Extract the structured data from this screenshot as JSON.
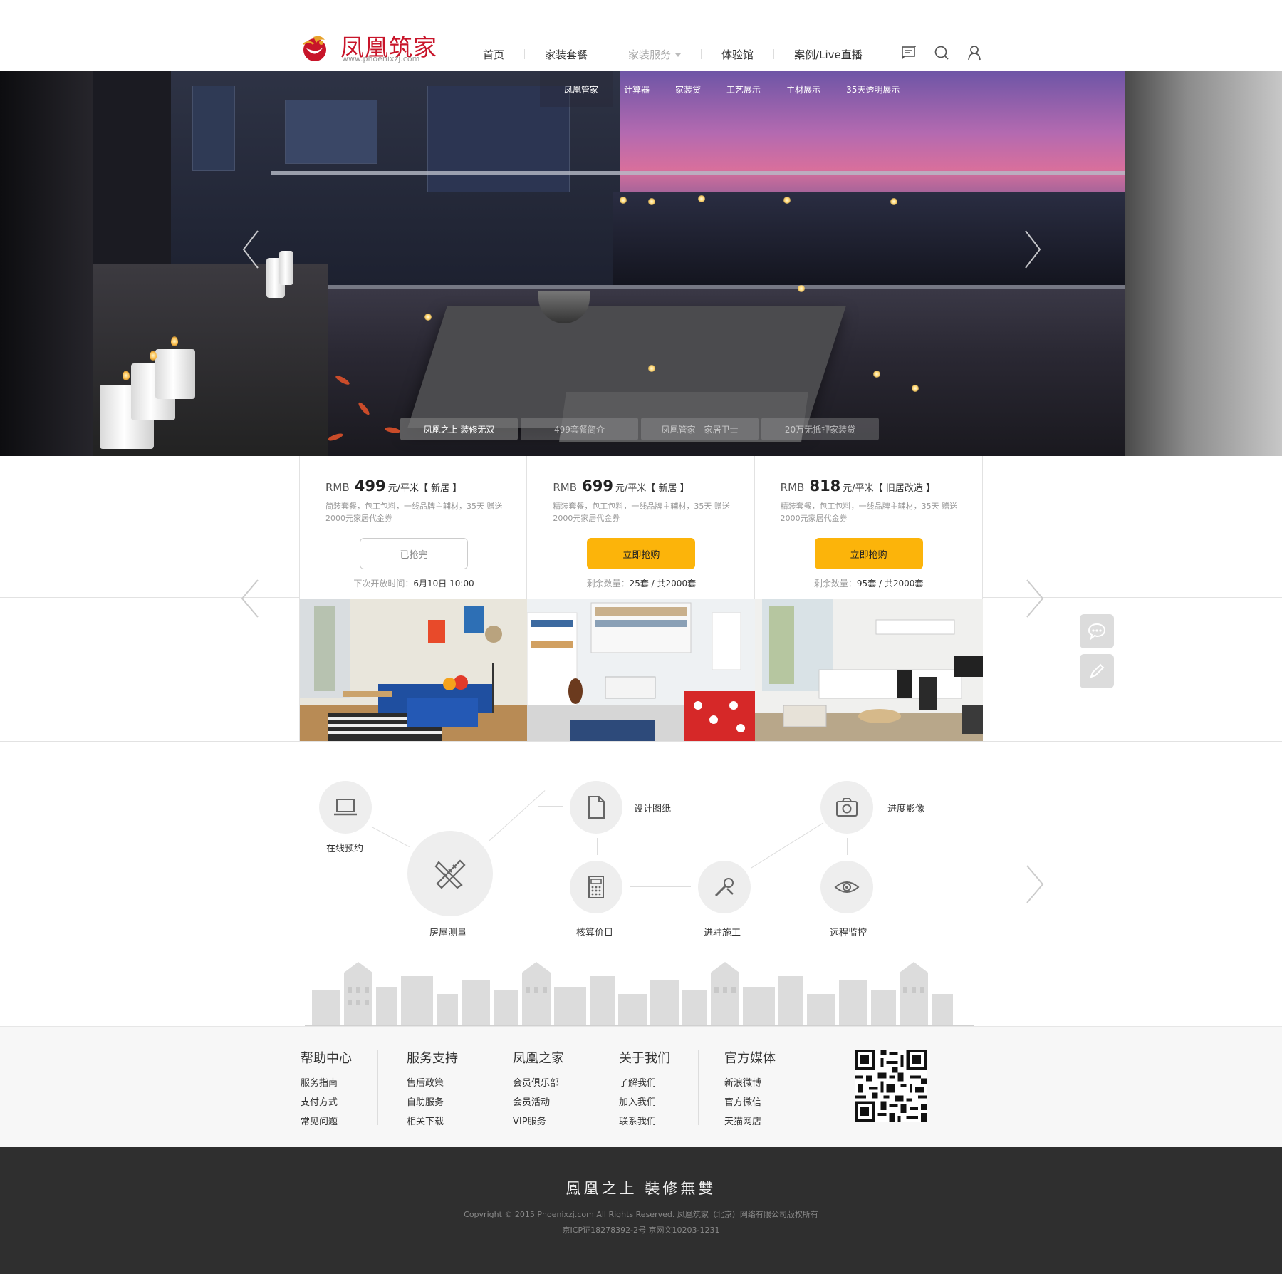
{
  "brand": {
    "name": "凤凰筑家",
    "url": "www.phoenixzj.com"
  },
  "nav": {
    "items": [
      {
        "label": "首页"
      },
      {
        "label": "家装套餐"
      },
      {
        "label": "家装服务"
      },
      {
        "label": "体验馆"
      },
      {
        "label": "案例/Live直播"
      }
    ],
    "tools": [
      "message-icon",
      "search-icon",
      "user-icon"
    ]
  },
  "subnav": {
    "items": [
      "凤凰管家",
      "计算器",
      "家装贷",
      "工艺展示",
      "主材展示",
      "35天透明展示"
    ]
  },
  "hero": {
    "tabs": [
      "凤凰之上  装修无双",
      "499套餐简介",
      "凤凰管家—家居卫士",
      "20万无抵押家装贷"
    ],
    "active_tab": 0
  },
  "packages": [
    {
      "currency": "RMB",
      "price": "499",
      "unit": "元/平米",
      "tag": "【 新居 】",
      "desc": "简装套餐，包工包料，一线品牌主辅材，35天 赠送2000元家居代金券",
      "button": "已抢完",
      "note_label": "下次开放时间：",
      "note_value": "6月10日 10:00",
      "sold_out": true
    },
    {
      "currency": "RMB",
      "price": "699",
      "unit": "元/平米",
      "tag": "【 新居 】",
      "desc": "精装套餐，包工包料，一线品牌主辅材，35天 赠送2000元家居代金券",
      "button": "立即抢购",
      "note_label": "剩余数量：",
      "note_value": "25套 / 共2000套",
      "sold_out": false
    },
    {
      "currency": "RMB",
      "price": "818",
      "unit": "元/平米",
      "tag": "【 旧居改造 】",
      "desc": "精装套餐，包工包料，一线品牌主辅材，35天 赠送2000元家居代金券",
      "button": "立即抢购",
      "note_label": "剩余数量：",
      "note_value": "95套 / 共2000套",
      "sold_out": false
    }
  ],
  "process": {
    "steps": [
      {
        "label": "在线预约",
        "icon": "laptop-icon"
      },
      {
        "label": "房屋测量",
        "icon": "ruler-pencil-icon"
      },
      {
        "label": "设计图纸",
        "icon": "document-icon"
      },
      {
        "label": "核算价目",
        "icon": "calculator-icon"
      },
      {
        "label": "进驻施工",
        "icon": "tools-icon"
      },
      {
        "label": "进度影像",
        "icon": "camera-icon"
      },
      {
        "label": "远程监控",
        "icon": "eye-icon"
      }
    ]
  },
  "footer": {
    "columns": [
      {
        "title": "帮助中心",
        "links": [
          "服务指南",
          "支付方式",
          "常见问题"
        ]
      },
      {
        "title": "服务支持",
        "links": [
          "售后政策",
          "自助服务",
          "相关下载"
        ]
      },
      {
        "title": "凤凰之家",
        "links": [
          "会员俱乐部",
          "会员活动",
          "VIP服务"
        ]
      },
      {
        "title": "关于我们",
        "links": [
          "了解我们",
          "加入我们",
          "联系我们"
        ]
      },
      {
        "title": "官方媒体",
        "links": [
          "新浪微博",
          "官方微信",
          "天猫网店"
        ]
      }
    ],
    "slogan": "鳳凰之上  裝修無雙",
    "copyright": "Copyright © 2015 Phoenixzj.com All Rights Reserved. 凤凰筑家（北京）网络有限公司版权所有",
    "icp": "京ICP证18278392-2号  京网文10203-1231"
  },
  "colors": {
    "brand_red": "#c8152a",
    "accent_yellow": "#fcb40a",
    "footer_dark": "#2f2f2f"
  }
}
